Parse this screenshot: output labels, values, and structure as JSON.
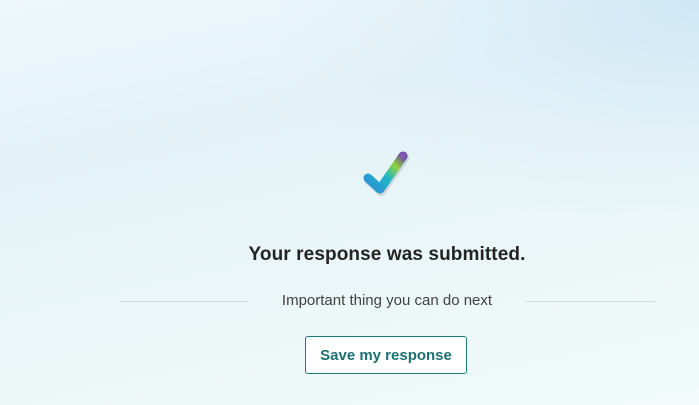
{
  "confirmation": {
    "icon": "checkmark-icon",
    "title": "Your response was submitted.",
    "next_step_label": "Important thing you can do next",
    "save_button_label": "Save my response"
  },
  "colors": {
    "accent": "#1f7a7a",
    "title_text": "#242424",
    "body_text": "#424242"
  }
}
